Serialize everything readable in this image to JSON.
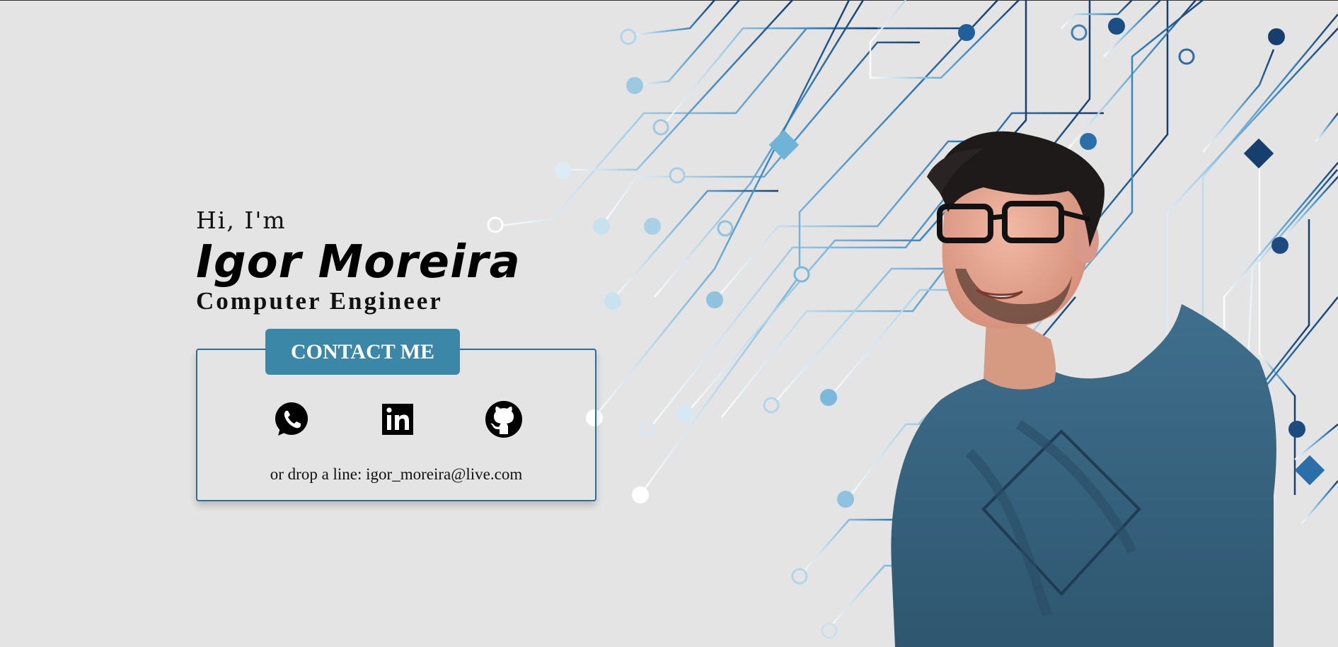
{
  "hero": {
    "greeting": "Hi, I'm",
    "name": "Igor Moreira",
    "title": "Computer Engineer"
  },
  "contact": {
    "button_label": "CONTACT ME",
    "links": [
      {
        "icon": "whatsapp-icon"
      },
      {
        "icon": "linkedin-icon"
      },
      {
        "icon": "github-icon"
      }
    ],
    "drop_line": "or drop a line: igor_moreira@live.com"
  },
  "colors": {
    "background": "#e4e4e4",
    "accent": "#3a87a8",
    "border": "#2a6f96",
    "circuit_dark": "#163f6e",
    "circuit_light": "#6fb3d8"
  }
}
